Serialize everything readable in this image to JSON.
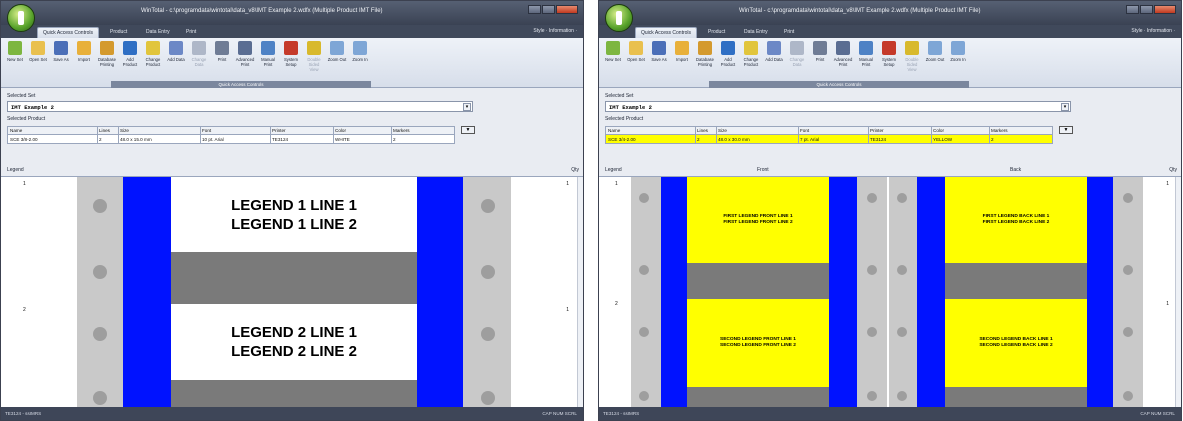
{
  "left": {
    "title": "WinTotal - c:\\programdata\\wintotal\\data_v8\\IMT Example 2.wdfx (Multiple Product IMT File)",
    "tabs": [
      "Quick Access Controls",
      "Product",
      "Data Entry",
      "Print"
    ],
    "style_menu": "Style · Information ·",
    "ribbon_buttons": [
      {
        "label": "New Set",
        "icon": "new-set-icon",
        "color": "#7db640"
      },
      {
        "label": "Open Set",
        "icon": "open-set-icon",
        "color": "#e9c04e"
      },
      {
        "label": "Save As",
        "icon": "save-as-icon",
        "color": "#4b6fb8"
      },
      {
        "label": "Import",
        "icon": "import-icon",
        "color": "#e8b03a"
      },
      {
        "label": "Database Printing",
        "icon": "database-icon",
        "color": "#d49a2e"
      },
      {
        "label": "Add Product",
        "icon": "add-product-icon",
        "color": "#2f6fc4"
      },
      {
        "label": "Change Product",
        "icon": "change-product-icon",
        "color": "#e1c53c"
      },
      {
        "label": "Add Data",
        "icon": "add-data-icon",
        "color": "#6c88c6"
      },
      {
        "label": "Change Data",
        "icon": "change-data-icon",
        "color": "#aeb7c8",
        "dim": true
      },
      {
        "label": "Print",
        "icon": "print-icon",
        "color": "#6f7c95"
      },
      {
        "label": "Advanced Print",
        "icon": "advanced-print-icon",
        "color": "#5a6d92"
      },
      {
        "label": "Manual Print",
        "icon": "manual-print-icon",
        "color": "#4e82c5"
      },
      {
        "label": "System Setup",
        "icon": "system-setup-icon",
        "color": "#c53a2a"
      },
      {
        "label": "Double Sided View",
        "icon": "double-sided-icon",
        "color": "#d8b92c",
        "dim": true
      },
      {
        "label": "Zoom Out",
        "icon": "zoom-out-icon",
        "color": "#7ea6d6"
      },
      {
        "label": "Zoom In",
        "icon": "zoom-in-icon",
        "color": "#7ea6d6"
      }
    ],
    "group_label": "Quick Access Controls",
    "selected_set_label": "Selected Set",
    "selected_set_value": "IMT Example 2",
    "selected_product_label": "Selected Product",
    "columns": [
      "Name",
      "Lines",
      "Size",
      "Font",
      "Printer",
      "Color",
      "Markers"
    ],
    "row": [
      "SCE 3/8-2.00",
      "2",
      "48.0 x 15.0 mm",
      "10 pt. Arial",
      "TE3124",
      "WHITE",
      "2"
    ],
    "legend_label": "Legend",
    "qty_label": "Qty",
    "rows": [
      {
        "num": "1",
        "qty": "1",
        "lines": [
          "LEGEND 1 LINE 1",
          "LEGEND 1 LINE 2"
        ]
      },
      {
        "num": "2",
        "qty": "1",
        "lines": [
          "LEGEND 2 LINE 1",
          "LEGEND 2 LINE 2"
        ]
      }
    ],
    "status_left": "TE3124 - ssIMRS",
    "status_right": "CAP NUM SCRL"
  },
  "right": {
    "title": "WinTotal - c:\\programdata\\wintotal\\data_v8\\IMT Example 2.wdfx (Multiple Product IMT File)",
    "tabs": [
      "Quick Access Controls",
      "Product",
      "Data Entry",
      "Print"
    ],
    "style_menu": "Style · Information ·",
    "group_label": "Quick Access Controls",
    "selected_set_label": "Selected Set",
    "selected_set_value": "IMT Example 2",
    "selected_product_label": "Selected Product",
    "columns": [
      "Name",
      "Lines",
      "Size",
      "Font",
      "Printer",
      "Color",
      "Markers"
    ],
    "row": [
      "SCE 3/4-2.00",
      "2",
      "48.0 x 30.0 mm",
      "7 pt. Arial",
      "TE3124",
      "YELLOW",
      "2"
    ],
    "legend_label": "Legend",
    "front_label": "Front",
    "back_label": "Back",
    "qty_label": "Qty",
    "rows": [
      {
        "num": "1",
        "qty": "1",
        "front": [
          "FIRST LEGEND FRONT LINE 1",
          "FIRST LEGEND FRONT LINE 2"
        ],
        "back": [
          "FIRST LEGEND BACK LINE 1",
          "FIRST LEGEND BACK LINE 2"
        ]
      },
      {
        "num": "2",
        "qty": "1",
        "front": [
          "SECOND LEGEND FRONT LINE 1",
          "SECOND LEGEND FRONT LINE 2"
        ],
        "back": [
          "SECOND LEGEND BACK LINE 1",
          "SECOND LEGEND BACK LINE 2"
        ]
      }
    ],
    "status_left": "TE3124 - ssIMRS",
    "status_right": "CAP NUM SCRL"
  },
  "colors": {
    "sleeve_blue": "#0012ff",
    "label_yellow": "#ffff00",
    "gap_gray": "#7a7a7a"
  }
}
